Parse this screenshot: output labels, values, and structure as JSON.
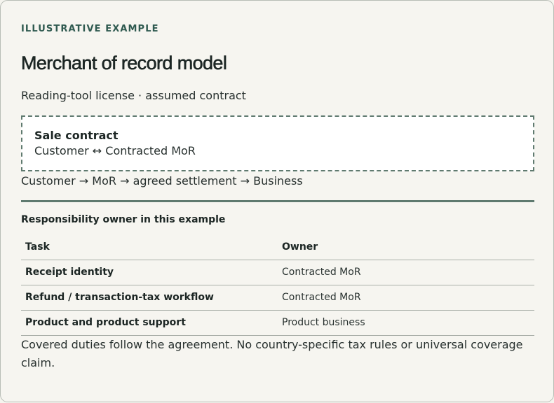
{
  "card": {
    "eyebrow": "ILLUSTRATIVE EXAMPLE",
    "title": "Merchant of record model",
    "subtitle": "Reading-tool license · assumed contract"
  },
  "contract": {
    "heading": "Sale contract",
    "parties": "Customer ↔ Contracted MoR"
  },
  "flow": "Customer → MoR → agreed settlement → Business",
  "responsibility": {
    "caption": "Responsibility owner in this example",
    "headers": {
      "task": "Task",
      "owner": "Owner"
    },
    "rows": [
      {
        "task": "Receipt identity",
        "owner": "Contracted MoR"
      },
      {
        "task": "Refund / transaction-tax workflow",
        "owner": "Contracted MoR"
      },
      {
        "task": "Product and product support",
        "owner": "Product business"
      }
    ]
  },
  "footnote": "Covered duties follow the agreement. No country-specific tax rules or universal coverage claim."
}
